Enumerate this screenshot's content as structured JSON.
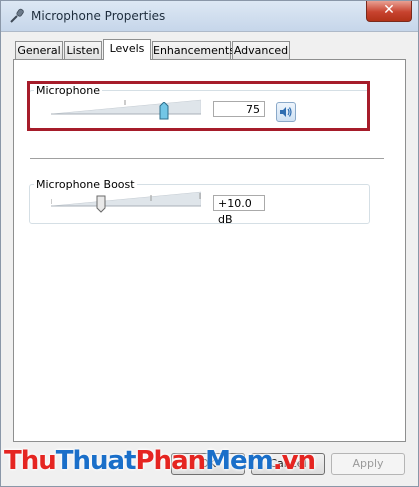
{
  "window": {
    "title": "Microphone Properties",
    "close_label": "✕",
    "icon": "microphone-icon"
  },
  "tabs": [
    {
      "label": "General",
      "active": false
    },
    {
      "label": "Listen",
      "active": false
    },
    {
      "label": "Levels",
      "active": true
    },
    {
      "label": "Enhancements",
      "active": false
    },
    {
      "label": "Advanced",
      "active": false
    }
  ],
  "levels": {
    "microphone": {
      "label": "Microphone",
      "value": "75",
      "level_percent": 75,
      "mute_icon": "speaker-icon"
    },
    "boost": {
      "label": "Microphone Boost",
      "value": "+10.0 dB",
      "level_fraction": 0.333
    }
  },
  "buttons": {
    "ok": "OK",
    "cancel": "Cancel",
    "apply": "Apply"
  },
  "watermark": {
    "parts": [
      "Thu",
      "Thuat",
      "Phan",
      "Mem",
      ".vn"
    ],
    "colors": [
      "#e52521",
      "#1a6fc9",
      "#e52521",
      "#1a6fc9",
      "#e52521"
    ]
  },
  "colors": {
    "highlight_border": "#a61c2a",
    "thumb_fill": "#73c6e6"
  }
}
